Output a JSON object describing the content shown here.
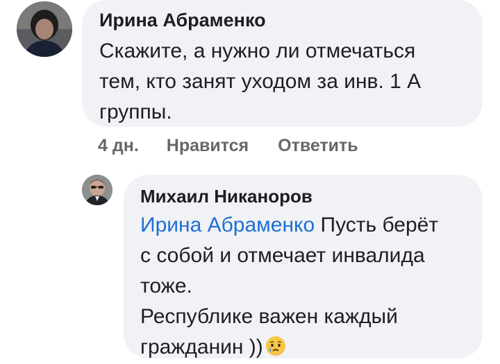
{
  "comment": {
    "author": "Ирина Абраменко",
    "text_lines": [
      "Скажите, а нужно ли отмечаться",
      "тем, кто занят уходом за инв. 1 А",
      "группы."
    ],
    "time": "4 дн.",
    "like_label": "Нравится",
    "reply_label": "Ответить"
  },
  "reply": {
    "author": "Михаил Никаноров",
    "mention": "Ирина Абраменко",
    "first_line_rest": " Пусть берёт",
    "text_lines": [
      "с собой и отмечает инвалида",
      "тоже.",
      "Республике важен каждый"
    ],
    "last_line": "гражданин ))",
    "emoji": "crying-face-emoji"
  },
  "colors": {
    "bubble_bg": "#f0f2f5",
    "text": "#1c1e21",
    "meta": "#65676b",
    "mention": "#1d6fd6"
  }
}
